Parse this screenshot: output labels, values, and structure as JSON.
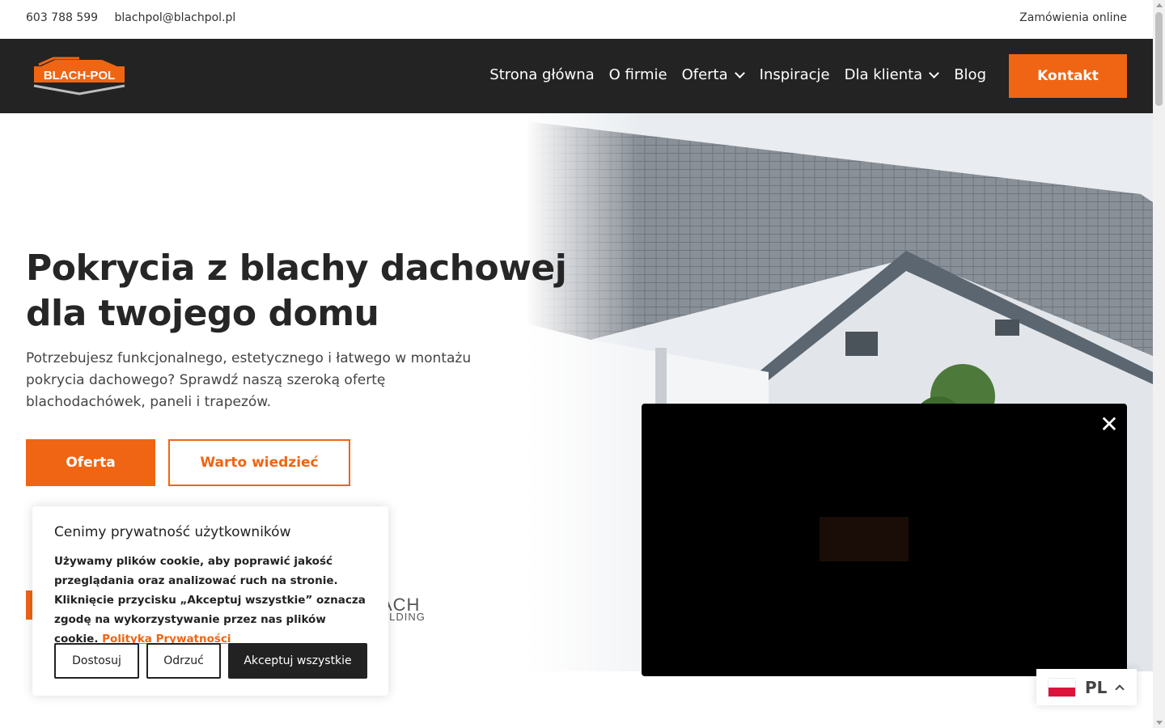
{
  "topbar": {
    "phone": "603 788 599",
    "email": "blachpol@blachpol.pl",
    "orders": "Zamówienia online"
  },
  "nav": {
    "logo_text": "BLACH-POL",
    "items": [
      {
        "label": "Strona główna",
        "dropdown": false
      },
      {
        "label": "O firmie",
        "dropdown": false
      },
      {
        "label": "Oferta",
        "dropdown": true
      },
      {
        "label": "Inspiracje",
        "dropdown": false
      },
      {
        "label": "Dla klienta",
        "dropdown": true
      },
      {
        "label": "Blog",
        "dropdown": false
      }
    ],
    "cta": "Kontakt"
  },
  "hero": {
    "title_line1": "Pokrycia z blachy dachowej",
    "title_line2": "dla twojego domu",
    "subtitle": "Potrzebujesz funkcjonalnego, estetycznego i łatwego w montażu pokrycia dachowego? Sprawdź naszą szeroką ofertę blachodachówek, paneli i trapezów.",
    "btn_primary": "Oferta",
    "btn_secondary": "Warto wiedzieć"
  },
  "partner": {
    "text_a": "ACH",
    "text_b": "OLDING"
  },
  "cookie": {
    "title": "Cenimy prywatność użytkowników",
    "body": "Używamy plików cookie, aby poprawić jakość przeglądania oraz analizować ruch na stronie. Kliknięcie przycisku „Akceptuj wszystkie” oznacza zgodę na wykorzystywanie przez nas plików cookie.",
    "policy_link": "Polityka Prywatności",
    "btn_customize": "Dostosuj",
    "btn_reject": "Odrzuć",
    "btn_accept": "Akceptuj wszystkie"
  },
  "video": {
    "close_glyph": "✕"
  },
  "language": {
    "code": "PL",
    "flag_colors": [
      "#ffffff",
      "#dc143c"
    ]
  },
  "colors": {
    "accent": "#ef6513",
    "nav_bg": "#232323"
  }
}
